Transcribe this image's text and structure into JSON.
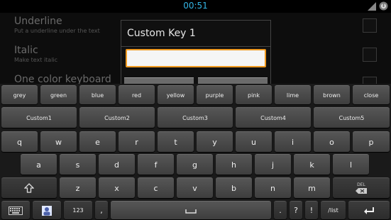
{
  "status": {
    "time": "00:51"
  },
  "settings": [
    {
      "title": "Underline",
      "subtitle": "Put a underline under the text"
    },
    {
      "title": "Italic",
      "subtitle": "Make text italic"
    },
    {
      "title": "One color keyboard",
      "subtitle": ""
    }
  ],
  "dialog": {
    "title": "Custom Key 1",
    "input_value": ""
  },
  "keyboard": {
    "colors": [
      "grey",
      "green",
      "blue",
      "red",
      "yellow",
      "purple",
      "pink",
      "lime",
      "brown",
      "close"
    ],
    "custom": [
      "Custom1",
      "Custom2",
      "Custom3",
      "Custom4",
      "Custom5"
    ],
    "row1": [
      "q",
      "w",
      "e",
      "r",
      "t",
      "y",
      "u",
      "i",
      "o",
      "p"
    ],
    "row2": [
      "a",
      "s",
      "d",
      "f",
      "g",
      "h",
      "j",
      "k",
      "l"
    ],
    "row3": [
      "z",
      "x",
      "c",
      "v",
      "b",
      "n",
      "m"
    ],
    "del_label": "DEL",
    "num_label": "123",
    "comma": ",",
    "period": ".",
    "question": "?",
    "exclaim": "!",
    "list_label": "/list"
  },
  "colors": {
    "accent": "#33b5e5",
    "input_border": "#f09a20"
  }
}
